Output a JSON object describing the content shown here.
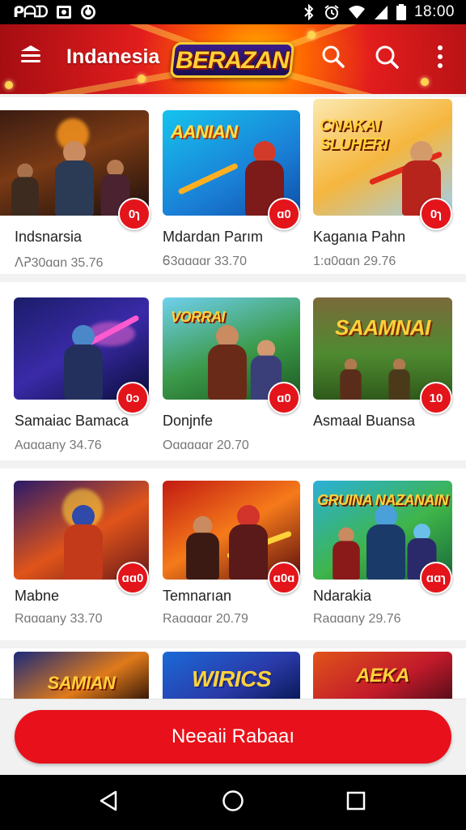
{
  "status_bar": {
    "left_text": "ᑭᗩᗪ",
    "time": "18:00",
    "icons": [
      "image-icon",
      "sync-icon",
      "bluetooth-icon",
      "alarm-icon",
      "wifi-icon",
      "signal-icon",
      "battery-icon"
    ]
  },
  "app_bar": {
    "title": "Indanesia",
    "logo_text": "BERAZAN",
    "icons": [
      "menu-icon",
      "search-icon",
      "search-icon",
      "more-vert-icon"
    ]
  },
  "colors": {
    "accent": "#e8101a",
    "badge": "#e4141b",
    "header_red": "#c8141a",
    "header_gold": "#ffb300"
  },
  "cards": [
    {
      "title": "Indsnarsia",
      "meta": "ᐱᕈ30ɑɑn 35.76",
      "badge": "0ɿ",
      "caption": ""
    },
    {
      "title": "Mdardan Parım",
      "meta": "Ꮾ3ɑɑɑɑr 33.70",
      "badge": "ɑ0",
      "caption": "AANIAN"
    },
    {
      "title": "Kaganıa Pahn",
      "meta": "1:ɑ0ɑɑn 29.76",
      "badge": "0ɿ",
      "caption": "CNAKAI SLUHERI"
    },
    {
      "title": "Samaiac Bamaca",
      "meta": "Aɑɑɑany 34.76",
      "badge": "0ɔ",
      "caption": ""
    },
    {
      "title": "Donjnfe",
      "meta": "Oɑɑɑɑɑr 20.70",
      "badge": "ɑ0",
      "caption": "VORRAI"
    },
    {
      "title": "Asmaal Buansa",
      "meta": "",
      "badge": "10",
      "caption": "SAAMNAI"
    },
    {
      "title": "Mabne",
      "meta": "Rɑɑɑany 33.70",
      "badge": "ɑɑ0",
      "caption": ""
    },
    {
      "title": "Temnarıan",
      "meta": "Raɑɑɑɑr 20.79",
      "badge": "ɑ0ɑ",
      "caption": ""
    },
    {
      "title": "Ndarakia",
      "meta": "Raɑɑɑny 29.76",
      "badge": "ɑɑɿ",
      "caption": "GRUINA NAZANAIN"
    },
    {
      "title": "",
      "meta": "",
      "badge": "",
      "caption": "SAMIAN"
    },
    {
      "title": "",
      "meta": "",
      "badge": "",
      "caption": "WIRICS"
    },
    {
      "title": "",
      "meta": "",
      "badge": "",
      "caption": "AEKA"
    }
  ],
  "cta": {
    "label": "Neeaii Rabaaı"
  },
  "nav_bar": {
    "icons": [
      "back-icon",
      "home-icon",
      "recents-icon"
    ]
  }
}
